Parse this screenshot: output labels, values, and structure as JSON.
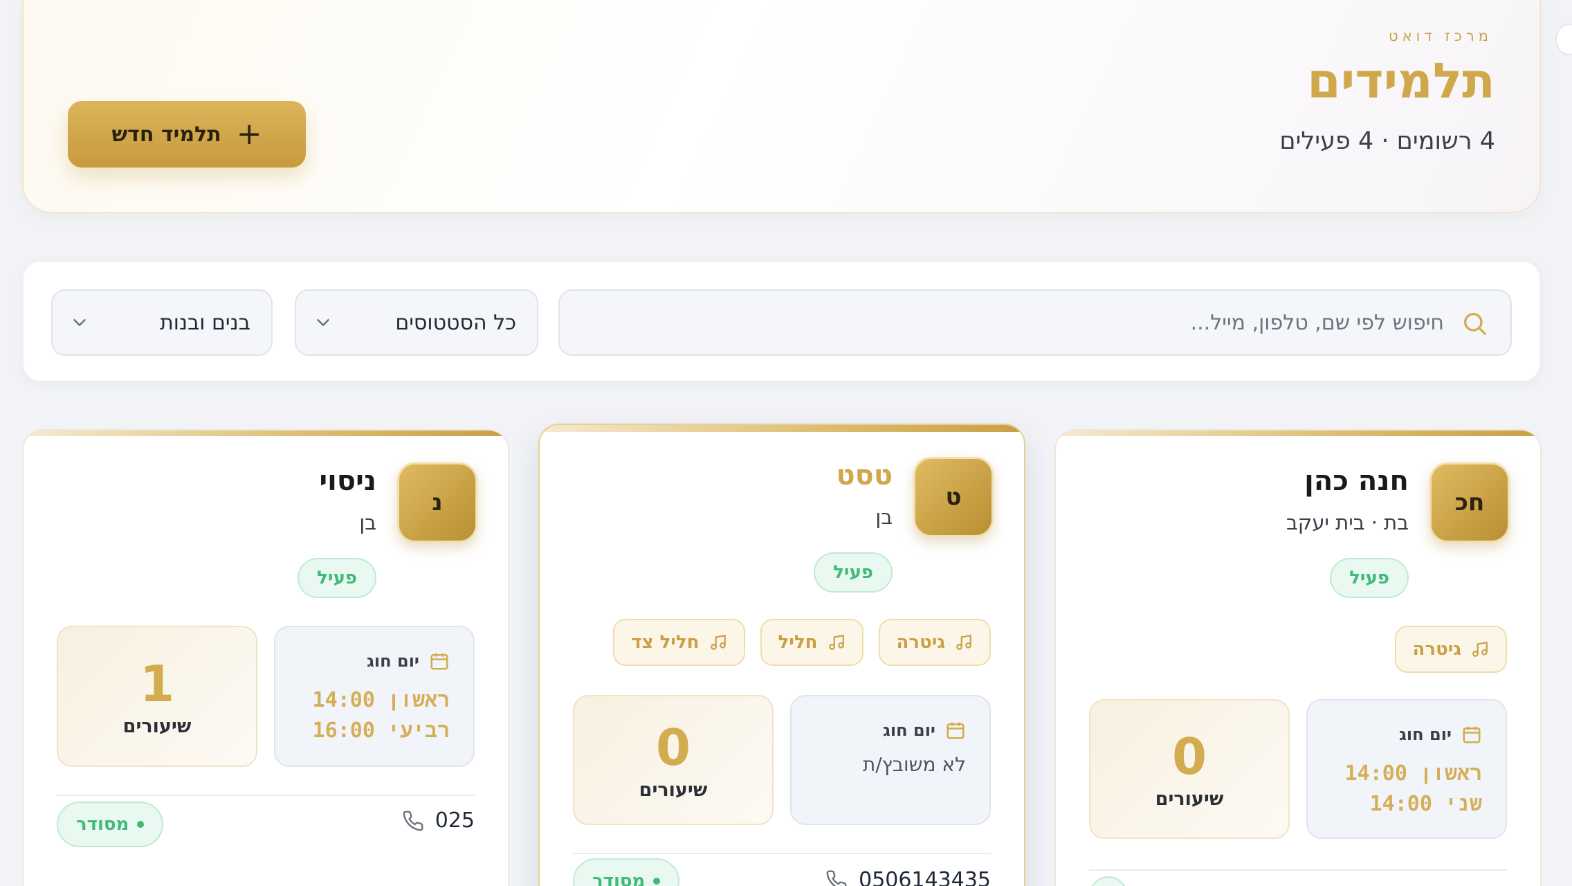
{
  "header": {
    "eyebrow": "מרכז דואט",
    "title": "תלמידים",
    "subtitle": "4 רשומים · 4 פעילים",
    "new_button_label": "תלמיד חדש",
    "new_button_icon": "plus-icon"
  },
  "filters": {
    "search_placeholder": "חיפוש לפי שם, טלפון, מייל...",
    "search_value": "",
    "status_selected": "כל הסטטוסים",
    "gender_selected": "בנים ובנות"
  },
  "colors": {
    "accent_gold": "#d0a84c",
    "status_green": "#3fba78",
    "background": "#f1f3f7"
  },
  "students": [
    {
      "initials": "חכ",
      "name": "חנה כהן",
      "meta": "בת · בית יעקב",
      "status": "פעיל",
      "instruments": [
        "גיטרה"
      ],
      "day_label": "יום חוג",
      "times": [
        "ראשון 14:00",
        "שני 14:00"
      ],
      "lessons_count": "0",
      "lessons_label": "שיעורים"
    },
    {
      "initials": "ט",
      "name": "טסט",
      "meta": "בן",
      "status": "פעיל",
      "instruments": [
        "גיטרה",
        "חליל",
        "חליל צד"
      ],
      "day_label": "יום חוג",
      "no_slot": "לא משובץ/ת",
      "lessons_count": "0",
      "lessons_label": "שיעורים",
      "phone": "0506143435",
      "arrangement": "מסודר"
    },
    {
      "initials": "נ",
      "name": "ניסוי",
      "meta": "בן",
      "status": "פעיל",
      "day_label": "יום חוג",
      "times": [
        "ראשון 14:00",
        "רביעי 16:00"
      ],
      "lessons_count": "1",
      "lessons_label": "שיעורים",
      "phone": "025",
      "arrangement": "מסודר"
    }
  ]
}
